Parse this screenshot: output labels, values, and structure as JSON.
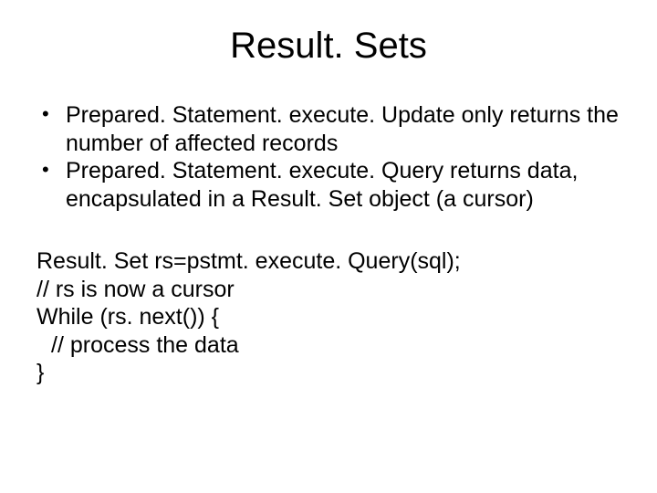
{
  "title": "Result. Sets",
  "bullets": [
    "Prepared. Statement. execute. Update only returns the number of affected records",
    "Prepared. Statement. execute. Query returns data, encapsulated in a Result. Set object (a cursor)"
  ],
  "code": {
    "line1": "Result. Set rs=pstmt. execute. Query(sql);",
    "line2": "// rs is now a cursor",
    "line3": "While (rs. next()) {",
    "line4": "// process the data",
    "line5": "}"
  }
}
